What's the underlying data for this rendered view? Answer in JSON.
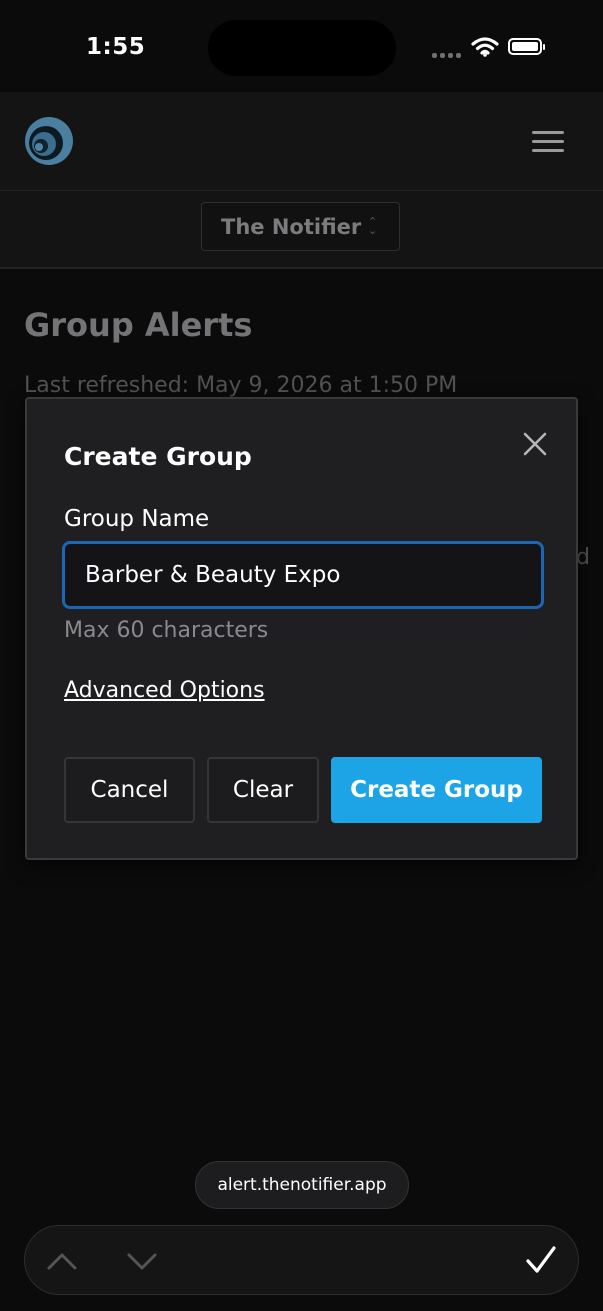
{
  "status_bar": {
    "time": "1:55"
  },
  "header": {
    "logo_icon": "notifier-logo",
    "menu_icon": "hamburger-menu-icon"
  },
  "app_selector": {
    "selected": "The Notifier"
  },
  "page": {
    "title": "Group Alerts",
    "last_refreshed": "Last refreshed: May 9, 2026 at 1:50 PM",
    "peek_text": "d"
  },
  "modal": {
    "title": "Create Group",
    "field_label": "Group Name",
    "input_value": "Barber & Beauty Expo",
    "helper": "Max 60 characters",
    "advanced_link": "Advanced Options",
    "buttons": {
      "cancel": "Cancel",
      "clear": "Clear",
      "create": "Create Group"
    }
  },
  "browser": {
    "url": "alert.thenotifier.app"
  },
  "colors": {
    "accent": "#1ca4e6",
    "focus_ring": "#1b67b3",
    "background": "#0b0b0c",
    "modal_bg": "#1f1f21"
  }
}
